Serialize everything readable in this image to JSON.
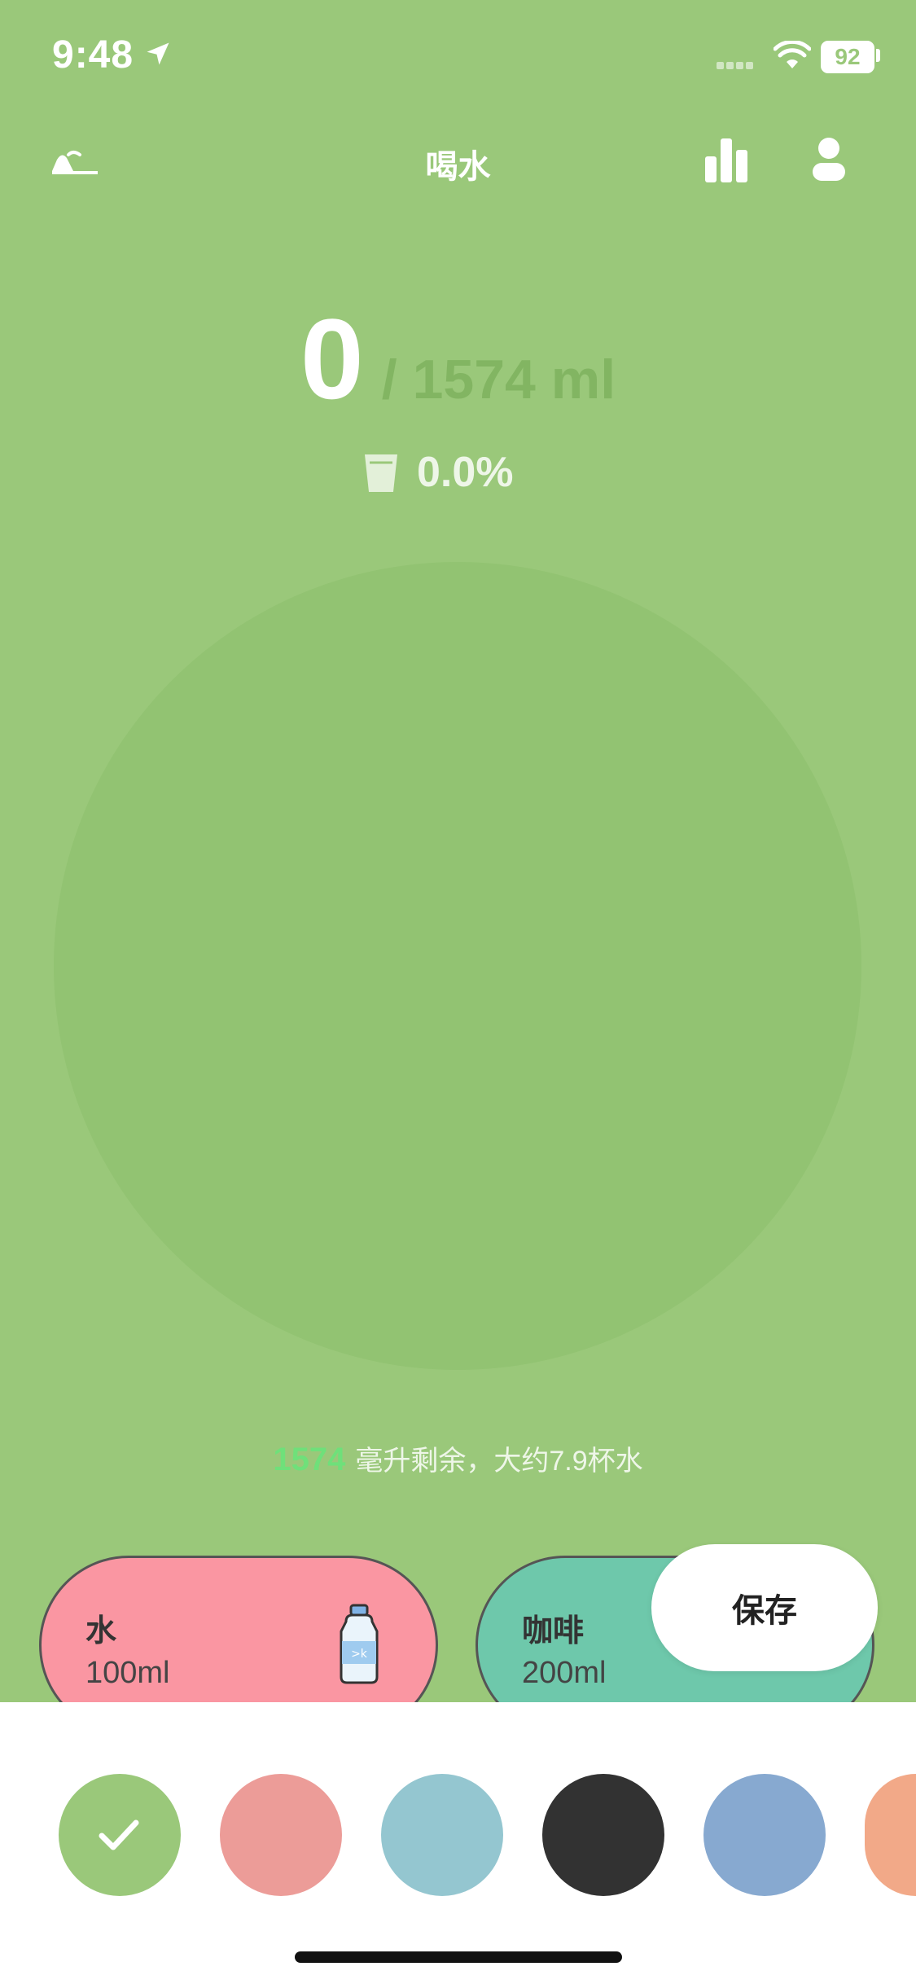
{
  "status_bar": {
    "time": "9:48",
    "battery": "92"
  },
  "header": {
    "title": "喝水",
    "back_icon": "hanger-back-icon",
    "stats_icon": "bar-chart-icon",
    "profile_icon": "user-icon"
  },
  "intake": {
    "current": "0",
    "goal": "/ 1574 ml",
    "percent": "0.0%"
  },
  "remaining": {
    "amount": "1574",
    "text": "毫升剩余，大约7.9杯水"
  },
  "drinks": [
    {
      "name": "水",
      "volume": "100ml",
      "color": "#fa96a2",
      "icon": "water-bottle-icon"
    },
    {
      "name": "咖啡",
      "volume": "200ml",
      "color": "#6ec8ab",
      "icon": "coffee-icon"
    }
  ],
  "save_label": "保存",
  "colors": [
    "#9ac87a",
    "#ec9c98",
    "#94c6d0",
    "#323232",
    "#87a9d0",
    "#f2a988"
  ],
  "selected_color_index": 0,
  "theme": {
    "background": "#9ac87a",
    "accent": "#6fe07a"
  }
}
